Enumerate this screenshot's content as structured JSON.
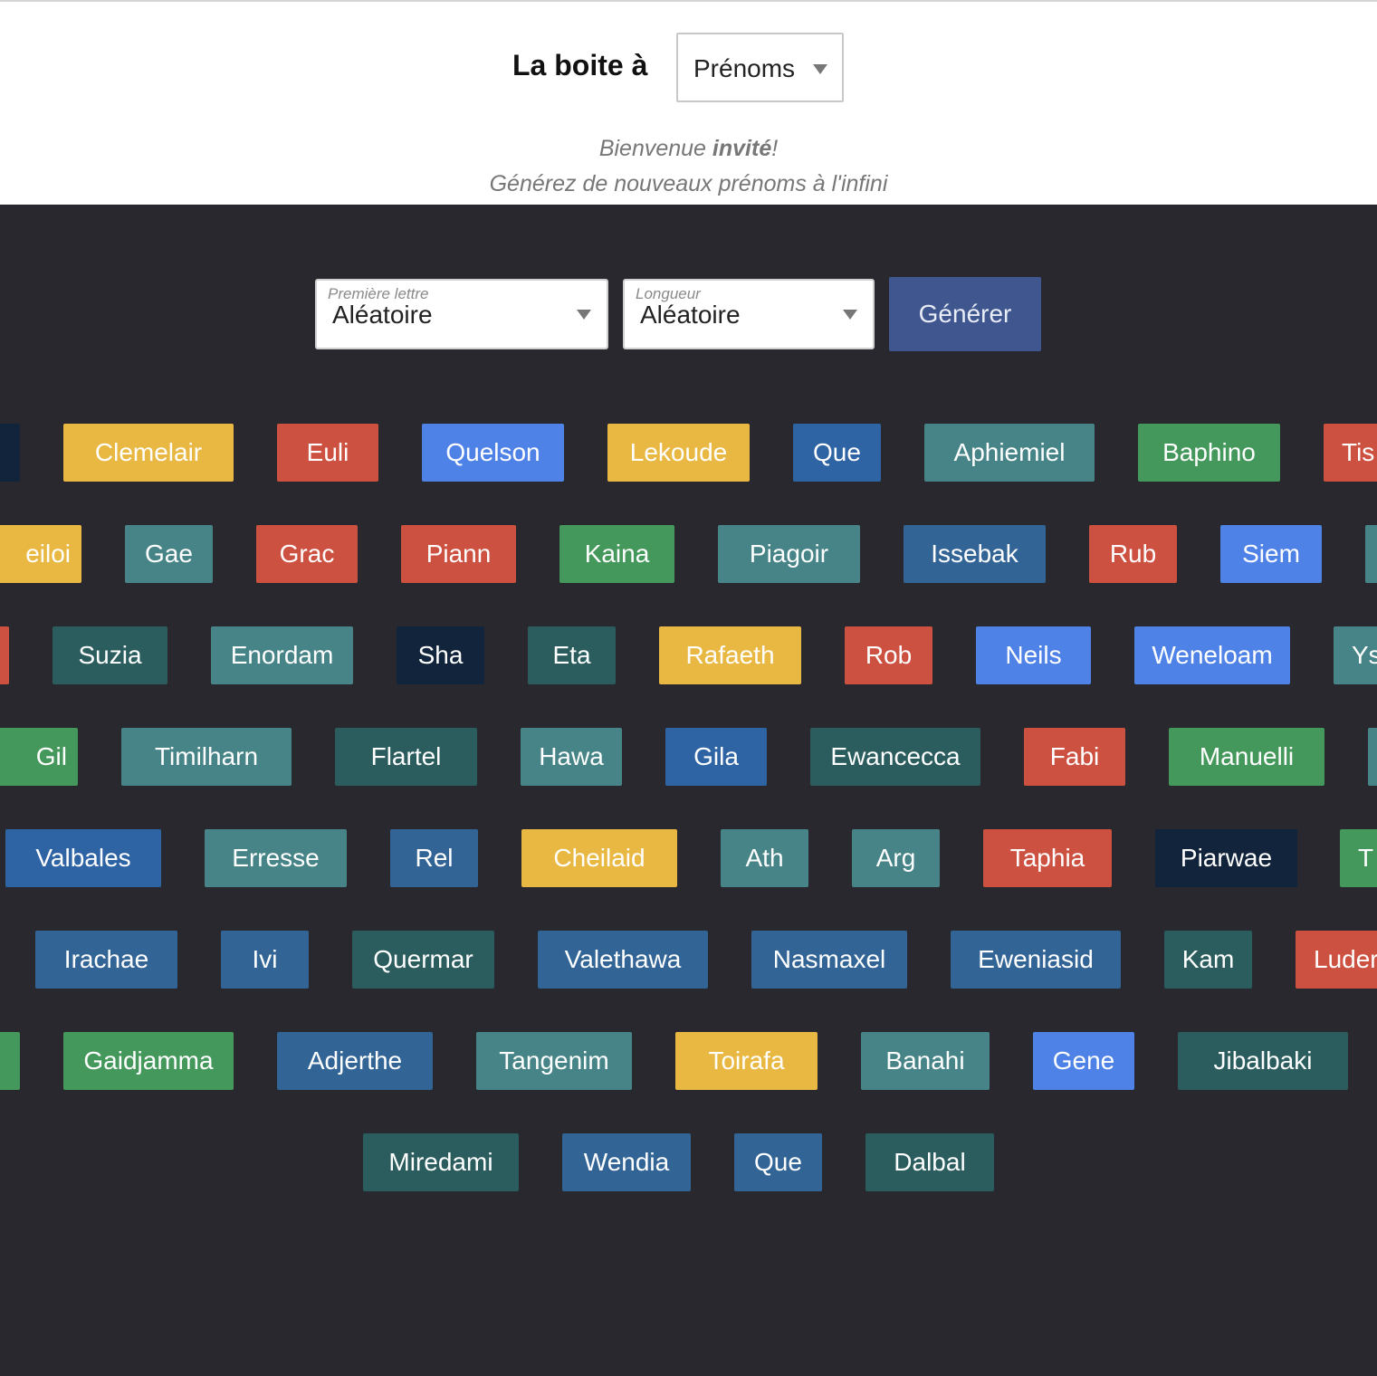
{
  "header": {
    "brand": "La boite à",
    "app_select": {
      "value": "Prénoms",
      "icon": "caret-down-icon"
    },
    "welcome_prefix": "Bienvenue ",
    "user": "invité",
    "welcome_suffix": "!",
    "subtitle": "Générez de nouveaux prénoms à l'infini"
  },
  "controls": {
    "first_letter": {
      "label": "Première lettre",
      "value": "Aléatoire"
    },
    "length": {
      "label": "Longueur",
      "value": "Aléatoire"
    },
    "generate_label": "Générer"
  },
  "colors": {
    "navy": "#11243b",
    "yellow": "#e8b842",
    "red": "#cd5141",
    "lightblue": "#4e82e6",
    "blue": "#2e63a4",
    "teal": "#478487",
    "green": "#45985b",
    "steel": "#326596",
    "darkteal": "#2b5d5f"
  },
  "names": [
    {
      "text": "",
      "color": "navy"
    },
    {
      "text": "Clemelair",
      "color": "yellow"
    },
    {
      "text": "Euli",
      "color": "red"
    },
    {
      "text": "Quelson",
      "color": "lightblue"
    },
    {
      "text": "Lekoude",
      "color": "yellow"
    },
    {
      "text": "Que",
      "color": "blue"
    },
    {
      "text": "Aphiemiel",
      "color": "teal"
    },
    {
      "text": "Baphino",
      "color": "green"
    },
    {
      "text": "Tis",
      "color": "red"
    },
    {
      "text": "eiloi",
      "color": "yellow"
    },
    {
      "text": "Gae",
      "color": "teal"
    },
    {
      "text": "Grac",
      "color": "red"
    },
    {
      "text": "Piann",
      "color": "red"
    },
    {
      "text": "Kaina",
      "color": "green"
    },
    {
      "text": "Piagoir",
      "color": "teal"
    },
    {
      "text": "Issebak",
      "color": "steel"
    },
    {
      "text": "Rub",
      "color": "red"
    },
    {
      "text": "Siem",
      "color": "lightblue"
    },
    {
      "text": "",
      "color": "teal"
    },
    {
      "text": "",
      "color": "red"
    },
    {
      "text": "Suzia",
      "color": "darkteal"
    },
    {
      "text": "Enordam",
      "color": "teal"
    },
    {
      "text": "Sha",
      "color": "navy"
    },
    {
      "text": "Eta",
      "color": "darkteal"
    },
    {
      "text": "Rafaeth",
      "color": "yellow"
    },
    {
      "text": "Rob",
      "color": "red"
    },
    {
      "text": "Neils",
      "color": "lightblue"
    },
    {
      "text": "Weneloam",
      "color": "lightblue"
    },
    {
      "text": "Ys",
      "color": "teal"
    },
    {
      "text": "Gil",
      "color": "green"
    },
    {
      "text": "Timilharn",
      "color": "teal"
    },
    {
      "text": "Flartel",
      "color": "darkteal"
    },
    {
      "text": "Hawa",
      "color": "teal"
    },
    {
      "text": "Gila",
      "color": "blue"
    },
    {
      "text": "Ewancecca",
      "color": "darkteal"
    },
    {
      "text": "Fabi",
      "color": "red"
    },
    {
      "text": "Manuelli",
      "color": "green"
    },
    {
      "text": "",
      "color": "teal"
    },
    {
      "text": "Valbales",
      "color": "blue"
    },
    {
      "text": "Erresse",
      "color": "teal"
    },
    {
      "text": "Rel",
      "color": "steel"
    },
    {
      "text": "Cheilaid",
      "color": "yellow"
    },
    {
      "text": "Ath",
      "color": "teal"
    },
    {
      "text": "Arg",
      "color": "teal"
    },
    {
      "text": "Taphia",
      "color": "red"
    },
    {
      "text": "Piarwae",
      "color": "navy"
    },
    {
      "text": "T",
      "color": "green"
    },
    {
      "text": "Irachae",
      "color": "steel"
    },
    {
      "text": "Ivi",
      "color": "steel"
    },
    {
      "text": "Quermar",
      "color": "darkteal"
    },
    {
      "text": "Valethawa",
      "color": "steel"
    },
    {
      "text": "Nasmaxel",
      "color": "steel"
    },
    {
      "text": "Eweniasid",
      "color": "steel"
    },
    {
      "text": "Kam",
      "color": "darkteal"
    },
    {
      "text": "Luder",
      "color": "red"
    },
    {
      "text": "",
      "color": "green"
    },
    {
      "text": "Gaidjamma",
      "color": "green"
    },
    {
      "text": "Adjerthe",
      "color": "steel"
    },
    {
      "text": "Tangenim",
      "color": "teal"
    },
    {
      "text": "Toirafa",
      "color": "yellow"
    },
    {
      "text": "Banahi",
      "color": "teal"
    },
    {
      "text": "Gene",
      "color": "lightblue"
    },
    {
      "text": "Jibalbaki",
      "color": "darkteal"
    },
    {
      "text": "Miredami",
      "color": "darkteal"
    },
    {
      "text": "Wendia",
      "color": "steel"
    },
    {
      "text": "Que",
      "color": "steel"
    },
    {
      "text": "Dalbal",
      "color": "darkteal"
    }
  ]
}
